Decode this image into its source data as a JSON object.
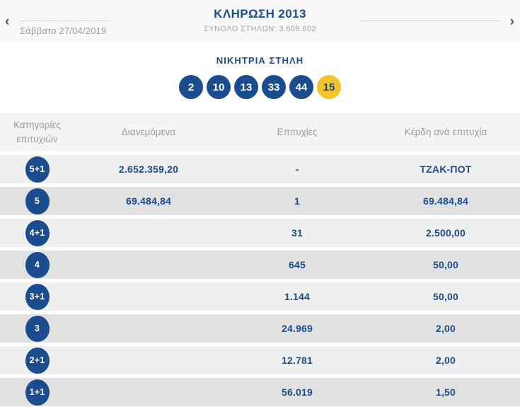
{
  "header": {
    "title": "ΚΛΗΡΩΣΗ 2013",
    "total_columns": "ΣΥΝΟΛΟ ΣΤΗΛΩΝ: 3.609.602",
    "date": "Σάββατο 27/04/2019",
    "prev_icon": "‹",
    "next_icon": "›"
  },
  "winning": {
    "title": "ΝΙΚΗΤΡΙΑ ΣΤΗΛΗ",
    "numbers": [
      "2",
      "10",
      "13",
      "33",
      "44"
    ],
    "bonus_number": "15"
  },
  "table": {
    "columns": [
      "Κατηγορίες επιτυχιών",
      "Διανεμόμενα",
      "Επιτυχίες",
      "Κέρδη ανά επιτυχία"
    ],
    "rows": [
      {
        "category": "5+1",
        "distributed": "2.652.359,20",
        "winners": "-",
        "prize": "ΤΖΑΚ-ΠΟΤ"
      },
      {
        "category": "5",
        "distributed": "69.484,84",
        "winners": "1",
        "prize": "69.484,84"
      },
      {
        "category": "4+1",
        "distributed": "",
        "winners": "31",
        "prize": "2.500,00"
      },
      {
        "category": "4",
        "distributed": "",
        "winners": "645",
        "prize": "50,00"
      },
      {
        "category": "3+1",
        "distributed": "",
        "winners": "1.144",
        "prize": "50,00"
      },
      {
        "category": "3",
        "distributed": "",
        "winners": "24.969",
        "prize": "2,00"
      },
      {
        "category": "2+1",
        "distributed": "",
        "winners": "12.781",
        "prize": "2,00"
      },
      {
        "category": "1+1",
        "distributed": "",
        "winners": "56.019",
        "prize": "1,50"
      }
    ]
  },
  "colors": {
    "navy": "#1b4d8e",
    "yellow": "#f3c32a",
    "gray-text": "#9b9b9b",
    "row-light": "#efefef",
    "row-dark": "#e1e1e1",
    "head-bg": "#f4f4f4",
    "bar-bg": "#f8f8f8"
  }
}
